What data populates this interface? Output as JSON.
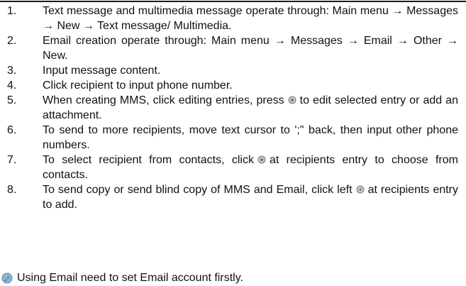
{
  "steps": [
    {
      "number": "1.",
      "parts": [
        {
          "type": "text",
          "value": "Text message and multimedia message operate through: Main menu → Messages → New → Text message/ Multimedia."
        }
      ]
    },
    {
      "number": "2.",
      "parts": [
        {
          "type": "text",
          "value": "Email creation operate through: Main menu → Messages → Email → Other → New."
        }
      ]
    },
    {
      "number": "3.",
      "parts": [
        {
          "type": "text",
          "value": "Input message content."
        }
      ]
    },
    {
      "number": "4.",
      "parts": [
        {
          "type": "text",
          "value": "Click recipient to input phone number."
        }
      ]
    },
    {
      "number": "5.",
      "parts": [
        {
          "type": "text",
          "value": "When creating MMS, click editing entries, press"
        },
        {
          "type": "icon",
          "icon": "ok-key-icon"
        },
        {
          "type": "text",
          "value": "to edit selected entry or add an attachment."
        }
      ]
    },
    {
      "number": "6.",
      "parts": [
        {
          "type": "text",
          "value": "To send to more recipients, move text cursor to ';\" back, then input other phone numbers."
        }
      ]
    },
    {
      "number": "7.",
      "parts": [
        {
          "type": "text",
          "value": "To select recipient from contacts, click"
        },
        {
          "type": "icon",
          "icon": "ok-key-icon"
        },
        {
          "type": "text",
          "value": "at recipients entry to choose from contacts."
        }
      ]
    },
    {
      "number": "8.",
      "parts": [
        {
          "type": "text",
          "value": "To send copy or send blind copy of MMS and Email, click left"
        },
        {
          "type": "icon",
          "icon": "left-soft-key-icon"
        },
        {
          "type": "text",
          "value": "at recipients entry to add."
        }
      ]
    }
  ],
  "note": {
    "icon": "note-icon",
    "text": "Using Email need to set Email account firstly."
  },
  "colors": {
    "text": "#111111",
    "rule": "#1a1a1a",
    "icon_fill": "#c8c8c8",
    "icon_stroke": "#7a7a7a",
    "note_icon_fill": "#8fb8d8"
  }
}
